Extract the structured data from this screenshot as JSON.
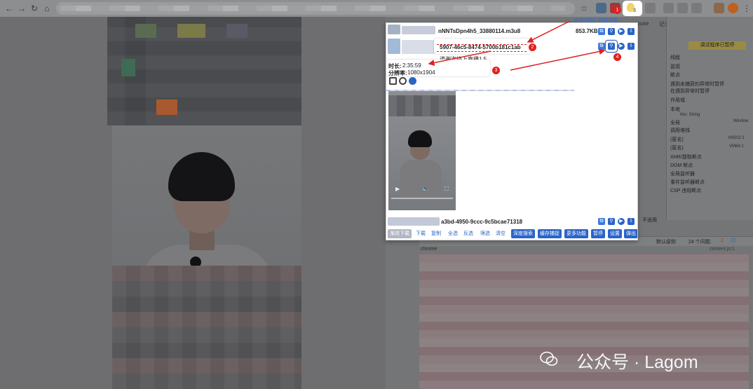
{
  "browser": {
    "extension_badge": "3"
  },
  "devtools": {
    "tabs": [
      "ouse",
      "记录器"
    ],
    "error_count": "43",
    "warning_count": "2",
    "paused_label": "调试程序已暂停",
    "sections": [
      "线程",
      "监视",
      "断点",
      "遇到未捕获的异常时暂停",
      "在遇到异常时暂停",
      "作用域",
      "本地",
      "全局",
      "调用堆栈",
      "(匿名)",
      "(匿名)",
      "XHR/提取断点",
      "DOM 断点",
      "全局监听器",
      "事件监听器断点",
      "CSP 违规断点"
    ],
    "scope_this": "this: String",
    "scope_global_val": "Window",
    "callstack_files": [
      "VM202:1",
      "VM64:1"
    ],
    "not_in_use": "不适用",
    "console": {
      "level_label": "默认级别",
      "issues_label": "24 个问题:",
      "issues_a": "2",
      "issues_b": "22",
      "first_line": "chrome",
      "first_source": "content.js:1"
    }
  },
  "popup": {
    "top_link_a": "其他功能",
    "top_link_sep": "|",
    "top_link_b": "网络设置",
    "file_name": "nNNTsDpn4h5_33880114.m3u8",
    "file_size": "853.7KB",
    "hash_id": "5907-46c5-8474-5700b181c1ab",
    "sub_title": "道谢次终上直播1.5",
    "duration_label": "时长:",
    "duration_value": "2:35:59",
    "resolution_label": "分辨率:",
    "resolution_value": "1080x1904",
    "row3_id": "a3bd-4950-9ccc-9c5bcae71318",
    "buttons": [
      "渐进下载",
      "下载",
      "复制",
      "全选",
      "反选",
      "筛选",
      "清空",
      "深度搜索",
      "缓存捕捉",
      "更多功能",
      "暂停",
      "设置",
      "弹出"
    ]
  },
  "markers": [
    "1",
    "2",
    "3",
    "4"
  ],
  "watermark": {
    "text": "公众号 · Lagom"
  },
  "colors": {
    "accent_blue": "#2a64c8",
    "annotation_red": "#e02020",
    "paused_yellow": "#9a8b42"
  }
}
